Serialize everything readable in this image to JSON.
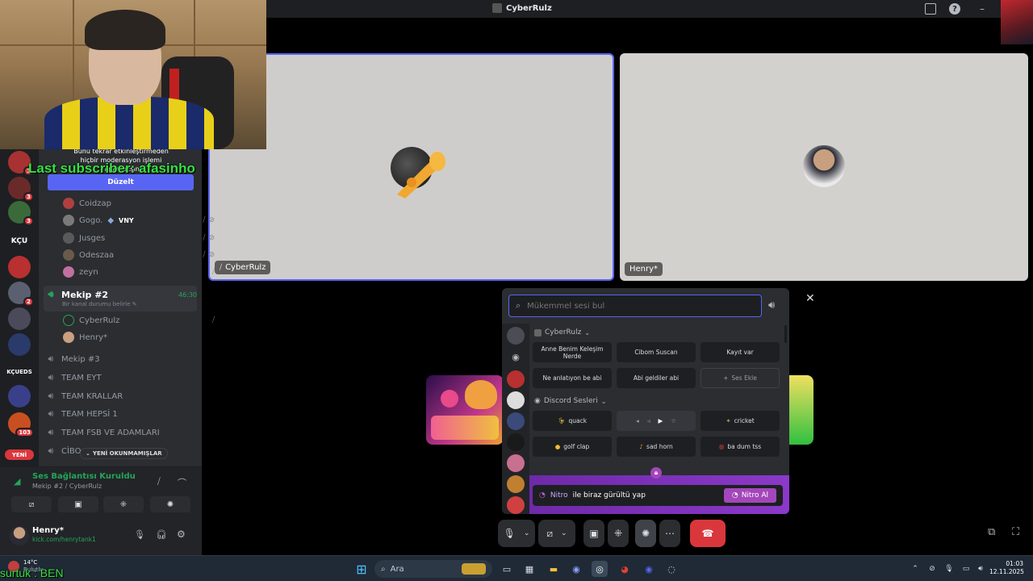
{
  "window": {
    "title": "CyberRulz"
  },
  "overlay": {
    "last_subscriber": "Last subscriber: afasinho",
    "bottom_text": "surtuk : BEN"
  },
  "moderation": {
    "text": "Bunu tekrar etkinleştirmeden hiçbir moderasyon işlemi yapamazsın.",
    "button": "Düzelt"
  },
  "servers": [
    {
      "label": "",
      "badge": "3",
      "color": "#a83232"
    },
    {
      "label": "",
      "badge": "3",
      "color": "#3a6a3a"
    },
    {
      "label": "KÇU",
      "badge": "",
      "color": "#1e1f22"
    },
    {
      "label": "",
      "badge": "2",
      "color": "#b83030"
    },
    {
      "label": "",
      "badge": "",
      "color": "#4a4a5a"
    },
    {
      "label": "",
      "badge": "",
      "color": "#2a3a6a"
    },
    {
      "label": "KÇUEDS",
      "badge": "",
      "color": "#1e1f22"
    },
    {
      "label": "",
      "badge": "",
      "color": "#3a3f8a"
    },
    {
      "label": "",
      "badge": "103",
      "color": "#c85020"
    }
  ],
  "channel_members_top": [
    {
      "name": "Coidzap",
      "tag": ""
    },
    {
      "name": "Gogo.",
      "tag": "VNY"
    },
    {
      "name": "Jusges",
      "tag": ""
    },
    {
      "name": "Odeszaa",
      "tag": ""
    },
    {
      "name": "zeyn",
      "tag": ""
    }
  ],
  "active_channel": {
    "name": "Mekip #2",
    "timer": "46:30",
    "status_hint": "Bir kanal durumu belirle",
    "members": [
      "CyberRulz",
      "Henry*"
    ]
  },
  "channels": [
    "Mekip #3",
    "TEAM EYT",
    "TEAM KRALLAR",
    "TEAM HEPSİ 1",
    "TEAM FSB VE ADAMLARI",
    "CİBO"
  ],
  "unread_pill": "YENİ OKUNMAMIŞLAR",
  "new_badge": "YENİ",
  "voice_status": {
    "title": "Ses Bağlantısı Kuruldu",
    "subtitle": "Mekip #2 / CyberRulz"
  },
  "user": {
    "name": "Henry*",
    "status": "kick.com/henrytank1"
  },
  "weather": {
    "temp": "14°C",
    "desc": "Bulutlu"
  },
  "tiles": [
    {
      "name": "CyberRulz"
    },
    {
      "name": "Henry*"
    }
  ],
  "soundboard": {
    "search_placeholder": "Mükemmel sesi bul",
    "server_section": "CyberRulz",
    "server_sounds": [
      {
        "label": "Anne Benim Keleşim Nerde"
      },
      {
        "label": "Cibom Suscan"
      },
      {
        "label": "Kayıt var"
      },
      {
        "label": "Ne anlatıyon be abi"
      },
      {
        "label": "Abi geldiler abi"
      },
      {
        "label": "Ses Ekle"
      }
    ],
    "discord_section": "Discord Sesleri",
    "discord_sounds": [
      {
        "label": "quack"
      },
      {
        "label": ""
      },
      {
        "label": "cricket"
      },
      {
        "label": "golf clap"
      },
      {
        "label": "sad horn"
      },
      {
        "label": "ba dum tss"
      }
    ],
    "nitro_text_brand": "Nitro",
    "nitro_text_rest": "ile biraz gürültü yap",
    "nitro_button": "Nitro Al"
  },
  "taskbar": {
    "search": "Ara",
    "time": "01:03",
    "date": "12.11.2025"
  }
}
